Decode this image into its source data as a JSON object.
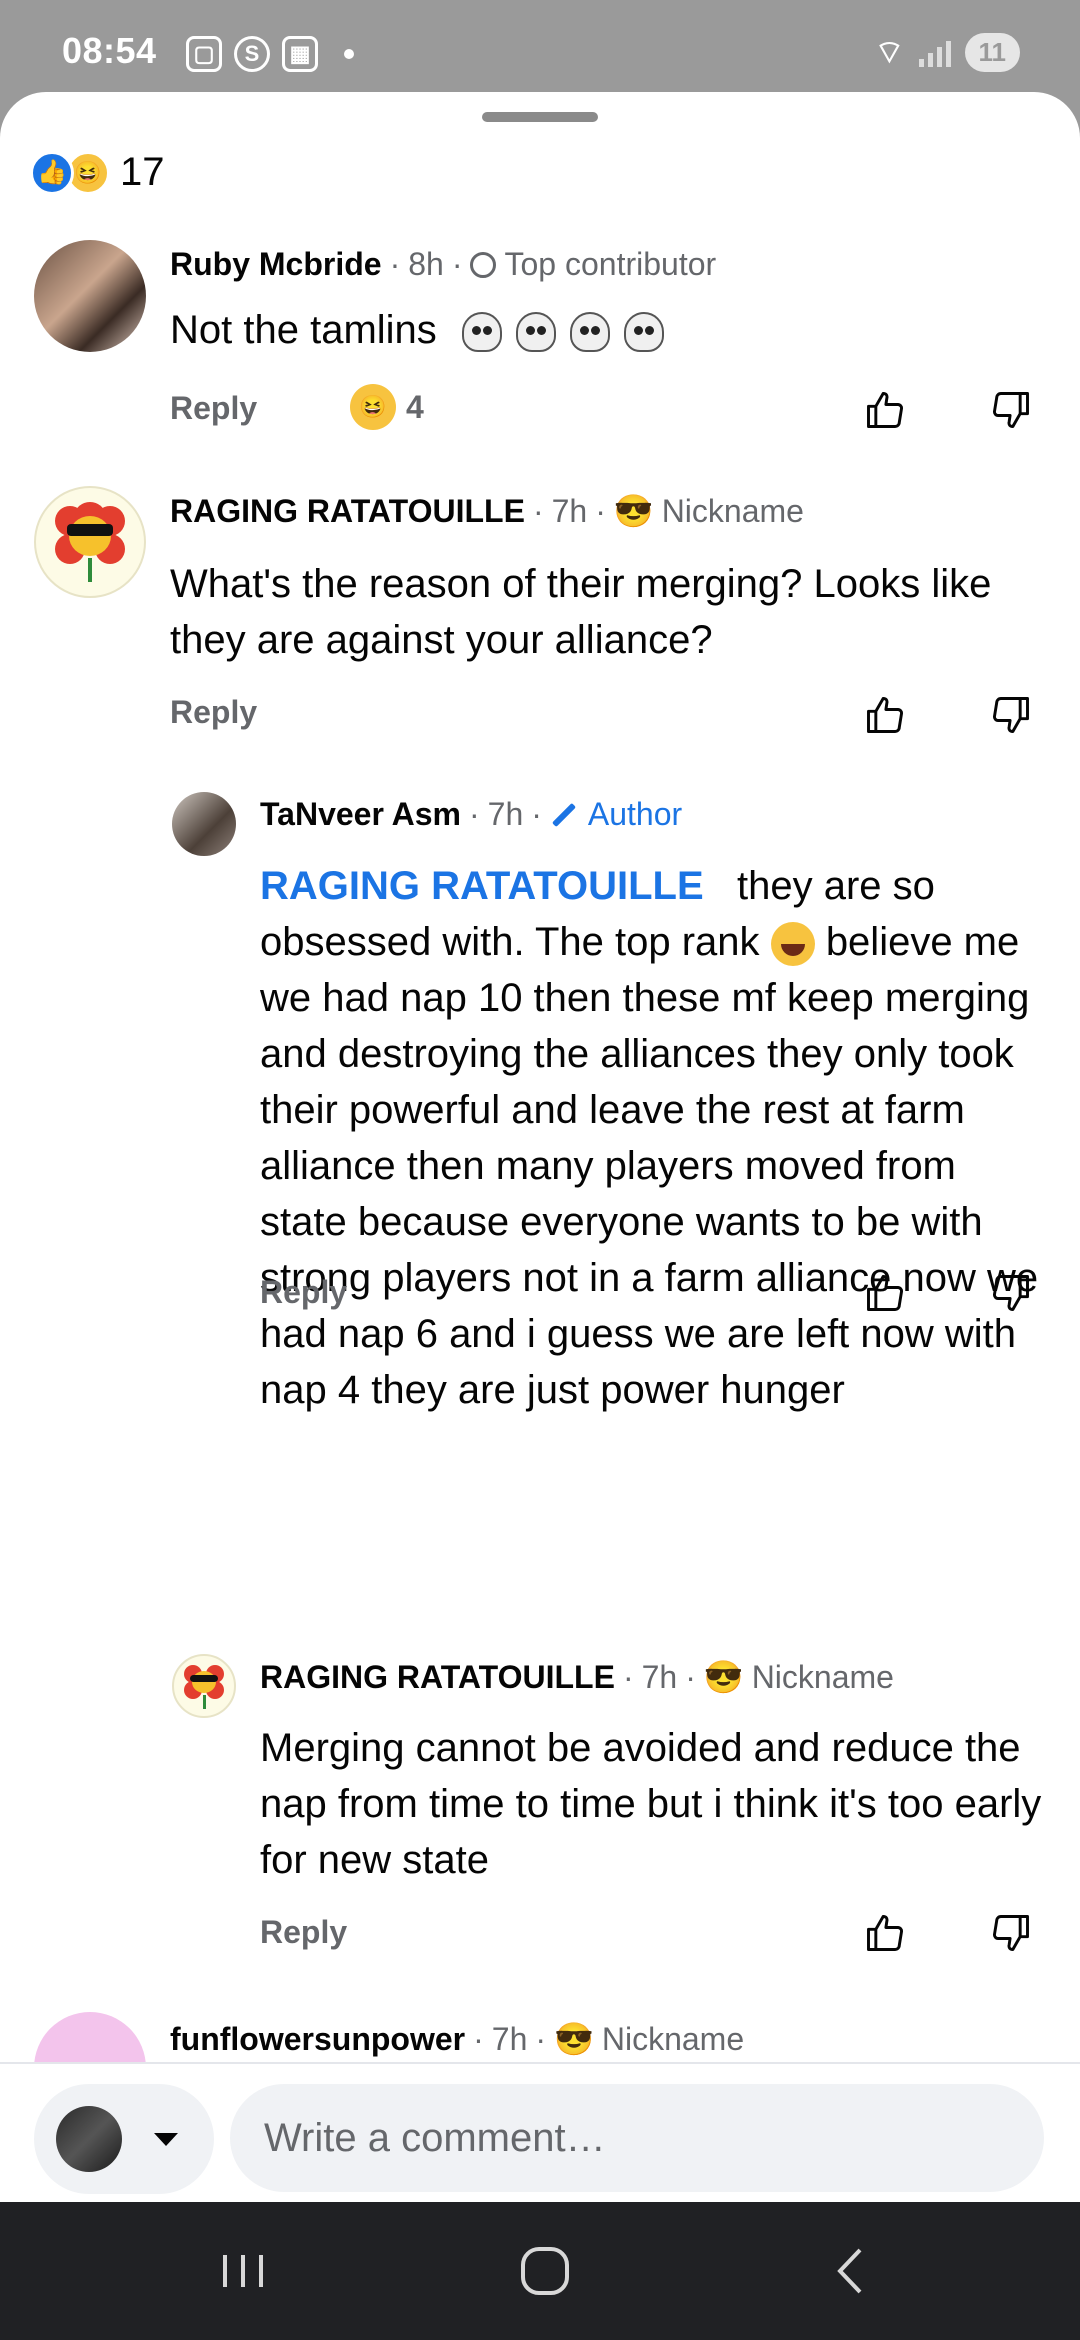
{
  "status_bar": {
    "time": "08:54",
    "battery": "11",
    "icons": [
      "screenshot-icon",
      "shazam-icon",
      "gallery-icon",
      "notification-dot-icon",
      "wifi-icon",
      "signal-icon"
    ]
  },
  "reactions": {
    "count": "17",
    "types": [
      "like-icon",
      "haha-icon"
    ]
  },
  "comments": [
    {
      "name": "Ruby Mcbride",
      "time": "8h",
      "badge": "Top contributor",
      "text": "Not the tamlins",
      "reply_label": "Reply",
      "reaction_count": "4"
    },
    {
      "name": "RAGING RATATOUILLE",
      "time": "7h",
      "badge": "Nickname",
      "text": "What's the reason of their merging? Looks like they are against your alliance?",
      "reply_label": "Reply"
    },
    {
      "name": "TaNveer Asm",
      "time": "7h",
      "badge": "Author",
      "mention": "RAGING RATATOUILLE",
      "text_part1": "they are so obsessed with. The top rank",
      "text_part2": "believe me we had nap 10 then these mf keep merging  and destroying the alliances  they only took their powerful and leave the rest at farm alliance then many players moved from state because everyone wants to be with strong players not in a farm alliance now we had nap 6  and i guess we are left now with nap 4 they are just power hunger",
      "reply_label": "Reply"
    },
    {
      "name": "RAGING RATATOUILLE",
      "time": "7h",
      "badge": "Nickname",
      "text": "Merging cannot be avoided and reduce the nap from time to time but i think it's too early for new state",
      "reply_label": "Reply"
    },
    {
      "name": "funflowersunpower",
      "time": "7h",
      "badge": "Nickname"
    }
  ],
  "composer": {
    "placeholder": "Write a comment…"
  },
  "colors": {
    "accent": "#1b74e4",
    "secondary_text": "#65676b",
    "status_bar": "#9a9a9a",
    "nav_bar": "#202124"
  }
}
